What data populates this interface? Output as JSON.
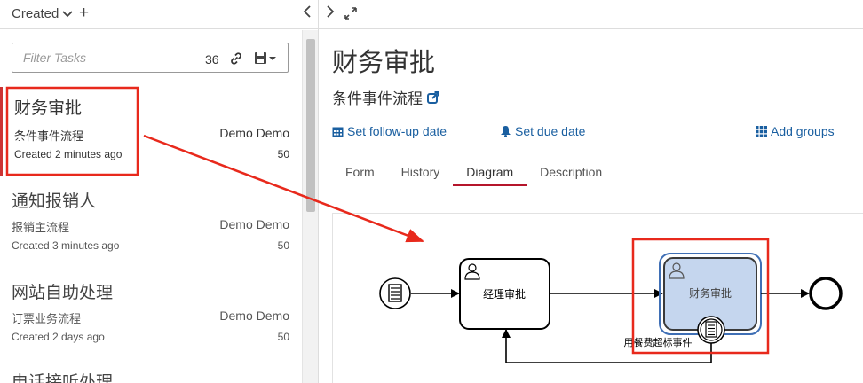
{
  "header": {
    "filter_label": "Created",
    "add_symbol": "+",
    "collapse_symbol": "‹",
    "expand_symbol": "›"
  },
  "filter": {
    "placeholder": "Filter Tasks",
    "count": "36"
  },
  "tasks": [
    {
      "name": "财务审批",
      "process": "条件事件流程",
      "assignee": "Demo Demo",
      "created": "Created 2 minutes ago",
      "priority": "50"
    },
    {
      "name": "通知报销人",
      "process": "报销主流程",
      "assignee": "Demo Demo",
      "created": "Created 3 minutes ago",
      "priority": "50"
    },
    {
      "name": "网站自助处理",
      "process": "订票业务流程",
      "assignee": "Demo Demo",
      "created": "Created 2 days ago",
      "priority": "50"
    },
    {
      "name": "电话接听处理",
      "process": "",
      "assignee": "",
      "created": "",
      "priority": ""
    }
  ],
  "detail": {
    "title": "财务审批",
    "process_name": "条件事件流程",
    "actions": {
      "follow_up": "Set follow-up date",
      "due": "Set due date",
      "groups": "Add groups"
    },
    "tabs": [
      "Form",
      "History",
      "Diagram",
      "Description"
    ],
    "active_tab": "Diagram"
  },
  "diagram": {
    "task1_label": "经理审批",
    "task2_label": "财务审批",
    "boundary_label": "用餐费超标事件"
  },
  "colors": {
    "link_blue": "#1a5fa0",
    "tab_underline": "#b5152b",
    "annotation_red": "#e8291c",
    "active_task_fill": "#c5d6ee",
    "active_task_border": "#3f6fb5"
  }
}
